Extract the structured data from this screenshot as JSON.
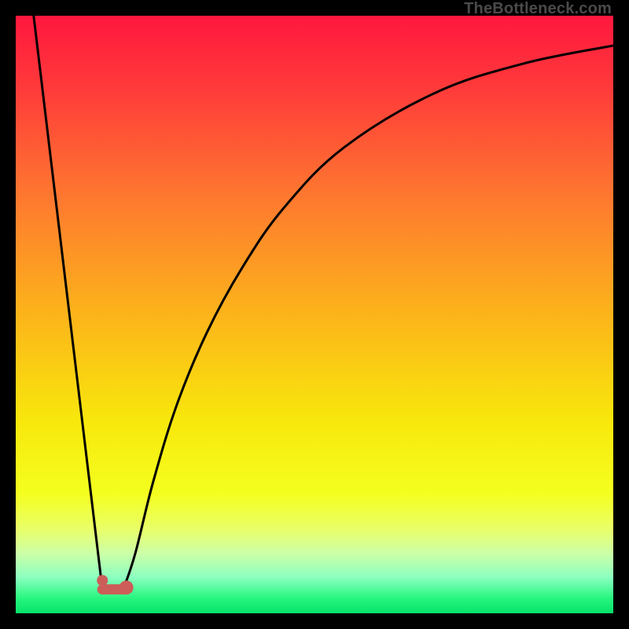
{
  "watermark": "TheBottleneck.com",
  "colors": {
    "frame": "#000000",
    "curve": "#000000",
    "marker_fill": "#cd5d58",
    "marker_stroke": "#cd5d58",
    "gradient_stops": [
      {
        "offset": 0.0,
        "color": "#ff173e"
      },
      {
        "offset": 0.12,
        "color": "#ff3a3a"
      },
      {
        "offset": 0.3,
        "color": "#fe7730"
      },
      {
        "offset": 0.5,
        "color": "#fcb41a"
      },
      {
        "offset": 0.68,
        "color": "#f8e80c"
      },
      {
        "offset": 0.8,
        "color": "#f4ff1f"
      },
      {
        "offset": 0.86,
        "color": "#e9ff6a"
      },
      {
        "offset": 0.9,
        "color": "#ccffa8"
      },
      {
        "offset": 0.94,
        "color": "#8bffc0"
      },
      {
        "offset": 0.975,
        "color": "#27f67f"
      },
      {
        "offset": 1.0,
        "color": "#06e26a"
      }
    ]
  },
  "chart_data": {
    "type": "line",
    "title": "",
    "xlabel": "",
    "ylabel": "",
    "xlim": [
      0,
      100
    ],
    "ylim": [
      0,
      100
    ],
    "series": [
      {
        "name": "left-branch",
        "x": [
          3,
          14.5
        ],
        "y": [
          100,
          4
        ]
      },
      {
        "name": "right-branch",
        "x": [
          18,
          20,
          23,
          27,
          32,
          38,
          45,
          55,
          70,
          85,
          100
        ],
        "y": [
          4,
          10,
          22,
          35,
          47,
          58,
          68,
          78,
          87,
          92,
          95
        ]
      }
    ],
    "markers": [
      {
        "name": "min-dot-left",
        "x": 14.5,
        "y": 5.5
      },
      {
        "name": "min-dot-right",
        "x": 18.5,
        "y": 4.3
      }
    ],
    "min_segment": {
      "from": {
        "x": 14.5,
        "y": 4
      },
      "to": {
        "x": 18.0,
        "y": 4
      }
    }
  }
}
